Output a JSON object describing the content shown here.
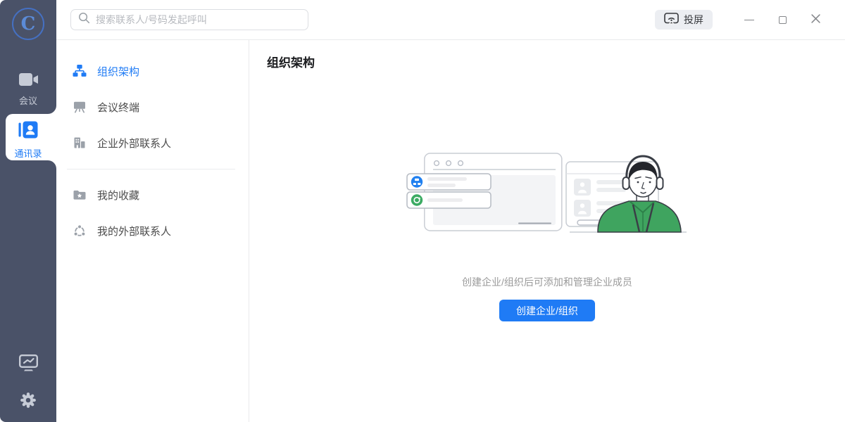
{
  "window": {
    "logo_letter": "C"
  },
  "topbar": {
    "search": {
      "placeholder": "搜索联系人/号码发起呼叫",
      "icon": "search-icon"
    },
    "cast_button": {
      "label": "投屏",
      "icon": "screen-cast-icon"
    },
    "window_controls": [
      {
        "icon": "minimize-icon"
      },
      {
        "icon": "maximize-icon"
      },
      {
        "icon": "close-icon"
      }
    ]
  },
  "primary_sidebar": {
    "items": [
      {
        "label": "会议",
        "icon": "video-camera-icon",
        "selected": false
      },
      {
        "label": "通讯录",
        "icon": "contacts-book-icon",
        "selected": true
      }
    ],
    "bottom_items": [
      {
        "icon": "stats-monitor-icon"
      },
      {
        "icon": "settings-gear-icon"
      }
    ]
  },
  "secondary_sidebar": {
    "group1": [
      {
        "label": "组织架构",
        "icon": "org-chart-icon",
        "selected": true
      },
      {
        "label": "会议终端",
        "icon": "meeting-terminal-icon",
        "selected": false
      },
      {
        "label": "企业外部联系人",
        "icon": "enterprise-buildings-icon",
        "selected": false
      }
    ],
    "group2": [
      {
        "label": "我的收藏",
        "icon": "favorites-folder-icon",
        "selected": false
      },
      {
        "label": "我的外部联系人",
        "icon": "external-contacts-network-icon",
        "selected": false
      }
    ]
  },
  "main": {
    "title": "组织架构",
    "empty_state": {
      "caption": "创建企业/组织后可添加和管理企业成员",
      "button_label": "创建企业/组织"
    }
  },
  "colors": {
    "accent_blue": "#1f7bf5",
    "sidebar_bg": "#4a5268",
    "illustration_green": "#3fa45f",
    "illustration_icon_blue": "#2080f0",
    "illustration_icon_green": "#3cab63"
  }
}
